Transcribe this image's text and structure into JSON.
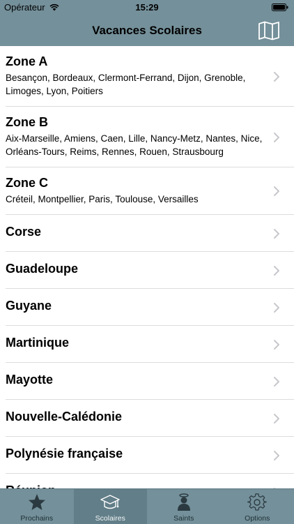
{
  "status": {
    "carrier": "Opérateur",
    "time": "15:29"
  },
  "nav": {
    "title": "Vacances Scolaires",
    "map_icon": "map-icon"
  },
  "zones": [
    {
      "title": "Zone A",
      "subtitle": "Besançon, Bordeaux, Clermont-Ferrand, Dijon, Grenoble, Limoges, Lyon, Poitiers"
    },
    {
      "title": "Zone B",
      "subtitle": "Aix-Marseille, Amiens, Caen, Lille, Nancy-Metz, Nantes, Nice, Orléans-Tours, Reims, Rennes, Rouen, Strausbourg"
    },
    {
      "title": "Zone C",
      "subtitle": "Créteil, Montpellier, Paris, Toulouse, Versailles"
    },
    {
      "title": "Corse"
    },
    {
      "title": "Guadeloupe"
    },
    {
      "title": "Guyane"
    },
    {
      "title": "Martinique"
    },
    {
      "title": "Mayotte"
    },
    {
      "title": "Nouvelle-Calédonie"
    },
    {
      "title": "Polynésie française"
    },
    {
      "title": "Réunion"
    }
  ],
  "tabs": [
    {
      "label": "Prochains",
      "icon": "star-icon",
      "active": false
    },
    {
      "label": "Scolaires",
      "icon": "graduation-cap-icon",
      "active": true
    },
    {
      "label": "Saints",
      "icon": "saint-icon",
      "active": false
    },
    {
      "label": "Options",
      "icon": "gear-icon",
      "active": false
    }
  ],
  "colors": {
    "bar": "#74909a",
    "active_tab": "#627e88",
    "separator": "#dcdcdc",
    "chevron": "#c7c7cc"
  }
}
